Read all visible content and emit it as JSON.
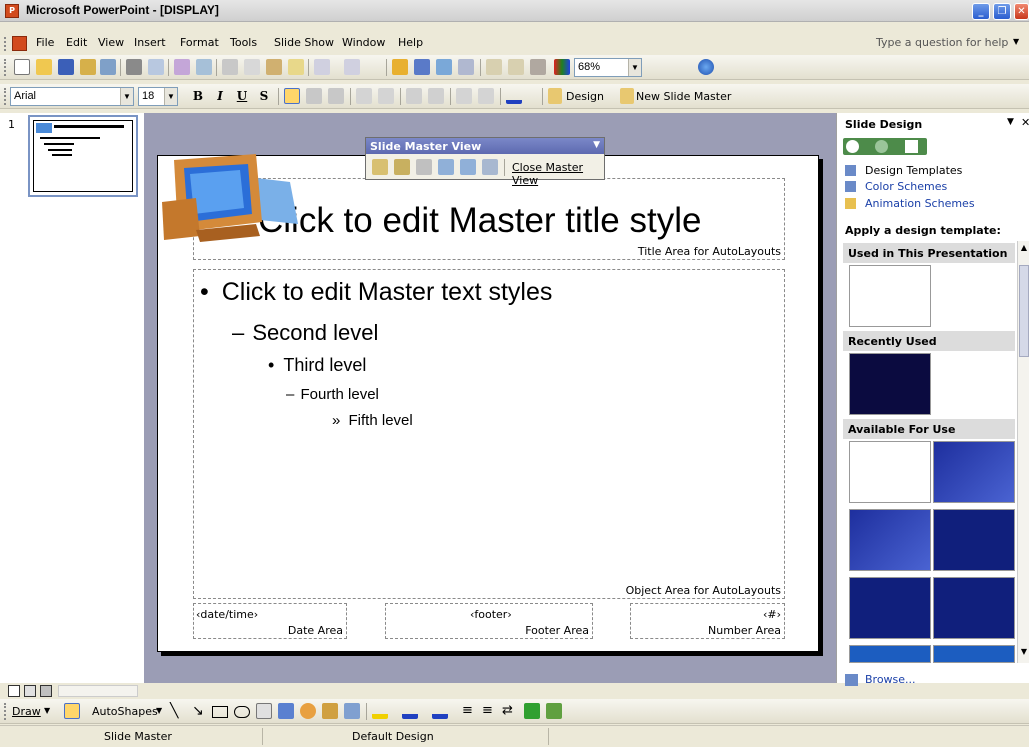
{
  "window": {
    "app_icon": "powerpoint-icon",
    "title": "Microsoft PowerPoint - [DISPLAY]"
  },
  "menubar": {
    "items": [
      "File",
      "Edit",
      "View",
      "Insert",
      "Format",
      "Tools",
      "Slide Show",
      "Window",
      "Help"
    ],
    "help_placeholder": "Type a question for help"
  },
  "standard_toolbar": {
    "zoom": "68%"
  },
  "formatting_toolbar": {
    "font": "Arial",
    "size": "18",
    "bold": "B",
    "italic": "I",
    "underline": "U",
    "shadow": "S",
    "design_label": "Design",
    "new_master_label": "New Slide Master"
  },
  "slides_panel": {
    "thumb_number": "1"
  },
  "slide_master_toolbar": {
    "title": "Slide Master View",
    "close_label": "Close Master View"
  },
  "slide": {
    "title": "Click to edit Master title style",
    "title_area_label": "Title Area for AutoLayouts",
    "body_levels": [
      {
        "bullet": "•",
        "text": "Click to edit Master text styles"
      },
      {
        "bullet": "–",
        "text": "Second level"
      },
      {
        "bullet": "•",
        "text": "Third level"
      },
      {
        "bullet": "–",
        "text": "Fourth level"
      },
      {
        "bullet": "»",
        "text": "Fifth level"
      }
    ],
    "object_area_label": "Object Area for AutoLayouts",
    "date_placeholder": "‹date/time›",
    "date_area_label": "Date Area",
    "footer_placeholder": "‹footer›",
    "footer_area_label": "Footer Area",
    "number_placeholder": "‹#›",
    "number_area_label": "Number Area"
  },
  "task_pane": {
    "title": "Slide Design",
    "links": [
      "Design Templates",
      "Color Schemes",
      "Animation Schemes"
    ],
    "apply_heading": "Apply a design template:",
    "section_used": "Used in This Presentation",
    "section_recent": "Recently Used",
    "section_available": "Available For Use",
    "browse": "Browse..."
  },
  "draw_toolbar": {
    "draw_label": "Draw",
    "autoshapes_label": "AutoShapes"
  },
  "status": {
    "left": "Slide Master",
    "design": "Default Design"
  },
  "colors": {
    "accent": "#316ac5",
    "workspace": "#9b9db5",
    "title_bar": "#d9d9d9"
  }
}
